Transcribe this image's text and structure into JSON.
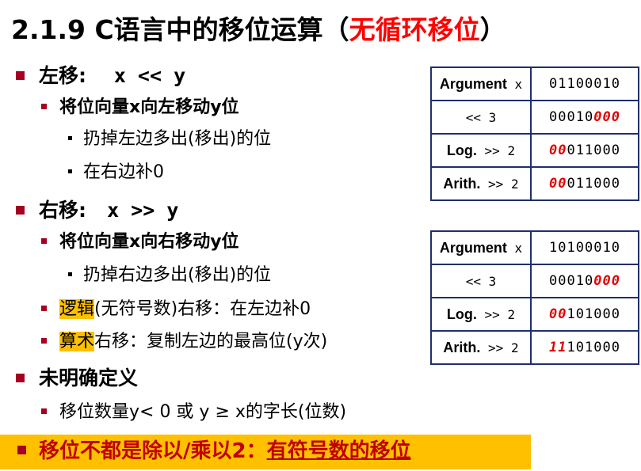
{
  "title": {
    "main": "2.1.9 C语言中的移位运算（",
    "highlight": "无循环移位",
    "close": "）"
  },
  "left_shift": {
    "label": "左移:",
    "expr": "x << y",
    "sub": "将位向量x向左移动y位",
    "items": [
      "扔掉左边多出(移出)的位",
      "在右边补0"
    ]
  },
  "right_shift": {
    "label": "右移:",
    "expr": "x >> y",
    "sub": "将位向量x向右移动y位",
    "items": [
      "扔掉右边多出(移出)的位"
    ],
    "logical_hl": "逻辑",
    "logical_rest": "(无符号数)右移：在左边补0",
    "arith_hl": "算术",
    "arith_rest": "右移：复制左边的最高位(y次)"
  },
  "undefined": {
    "label": "未明确定义",
    "item": "移位数量y< 0 或 y ≥ x的字长(位数)"
  },
  "footer": {
    "prefix": "移位不都是除以/乘以2：",
    "underlined": "有符号数的移位"
  },
  "table1": {
    "rows": [
      {
        "label": "Argument",
        "op": " x",
        "bits_red": "",
        "bits": "01100010",
        "bits_red_tail": ""
      },
      {
        "label": "",
        "op": "<< 3",
        "bits_red": "",
        "bits": "00010",
        "bits_red_tail": "000"
      },
      {
        "label": "Log.",
        "op": " >> 2",
        "bits_red": "00",
        "bits": "011000",
        "bits_red_tail": ""
      },
      {
        "label": "Arith.",
        "op": " >> 2",
        "bits_red": "00",
        "bits": "011000",
        "bits_red_tail": ""
      }
    ]
  },
  "table2": {
    "rows": [
      {
        "label": "Argument",
        "op": " x",
        "bits_red": "",
        "bits": "10100010",
        "bits_red_tail": ""
      },
      {
        "label": "",
        "op": "<< 3",
        "bits_red": "",
        "bits": "00010",
        "bits_red_tail": "000"
      },
      {
        "label": "Log.",
        "op": " >> 2",
        "bits_red": "00",
        "bits": "101000",
        "bits_red_tail": ""
      },
      {
        "label": "Arith.",
        "op": " >> 2",
        "bits_red": "11",
        "bits": "101000",
        "bits_red_tail": ""
      }
    ]
  },
  "colors": {
    "accent_red": "#ff0000",
    "highlight": "#ffc000",
    "bullet": "#a50021",
    "table_border": "#1f2f6b"
  }
}
